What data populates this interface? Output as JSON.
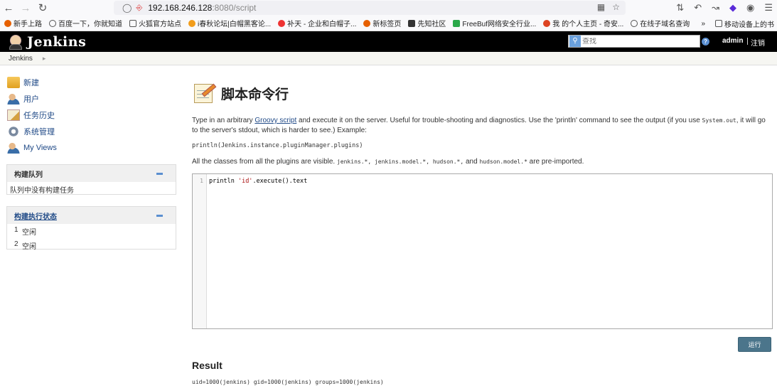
{
  "browser": {
    "url_host": "192.168.246.128",
    "url_path": ":8080/script",
    "bookmarks": [
      "新手上路",
      "百度一下，你就知道",
      "火狐官方站点",
      "i春秋论坛|白帽黑客论...",
      "补天 - 企业和白帽子...",
      "新标签页",
      "先知社区",
      "FreeBuf网络安全行业...",
      "我 的个人主页 - 奇安...",
      "在线子域名查询"
    ],
    "mobile_bookmarks": "移动设备上的书"
  },
  "header": {
    "logo_text": "Jenkins",
    "search_placeholder": "查找",
    "help_icon": "?",
    "user": "admin",
    "logout": "注销"
  },
  "breadcrumb": {
    "root": "Jenkins"
  },
  "sidebar": {
    "tasks": [
      {
        "label": "新建",
        "icon": "new-item-icon"
      },
      {
        "label": "用户",
        "icon": "users-icon"
      },
      {
        "label": "任务历史",
        "icon": "history-icon"
      },
      {
        "label": "系统管理",
        "icon": "gear-icon"
      },
      {
        "label": "My Views",
        "icon": "views-icon"
      }
    ],
    "queue": {
      "title": "构建队列",
      "empty": "队列中没有构建任务"
    },
    "executors": {
      "title": "构建执行状态",
      "rows": [
        {
          "num": "1",
          "status": "空闲"
        },
        {
          "num": "2",
          "status": "空闲"
        }
      ]
    }
  },
  "main": {
    "title": "脚本命令行",
    "desc_part1": "Type in an arbitrary ",
    "desc_link": "Groovy script",
    "desc_part2": " and execute it on the server. Useful for trouble-shooting and diagnostics. Use the 'println' command to see the output (if you use ",
    "desc_code": "System.out",
    "desc_part3": ", it will go to the server's stdout, which is harder to see.) Example:",
    "example": "println(Jenkins.instance.pluginManager.plugins)",
    "imports_part1": "All the classes from all the plugins are visible. ",
    "imports_code": "jenkins.*, jenkins.model.*, hudson.*,",
    "imports_part2": " and ",
    "imports_code2": "hudson.model.*",
    "imports_part3": " are pre-imported.",
    "line_number": "1",
    "code_prefix": "println ",
    "code_string": "'id'",
    "code_suffix": ".execute().text",
    "run_button": "运行",
    "result_title": "Result",
    "result_output": "uid=1000(jenkins) gid=1000(jenkins) groups=1000(jenkins)"
  }
}
